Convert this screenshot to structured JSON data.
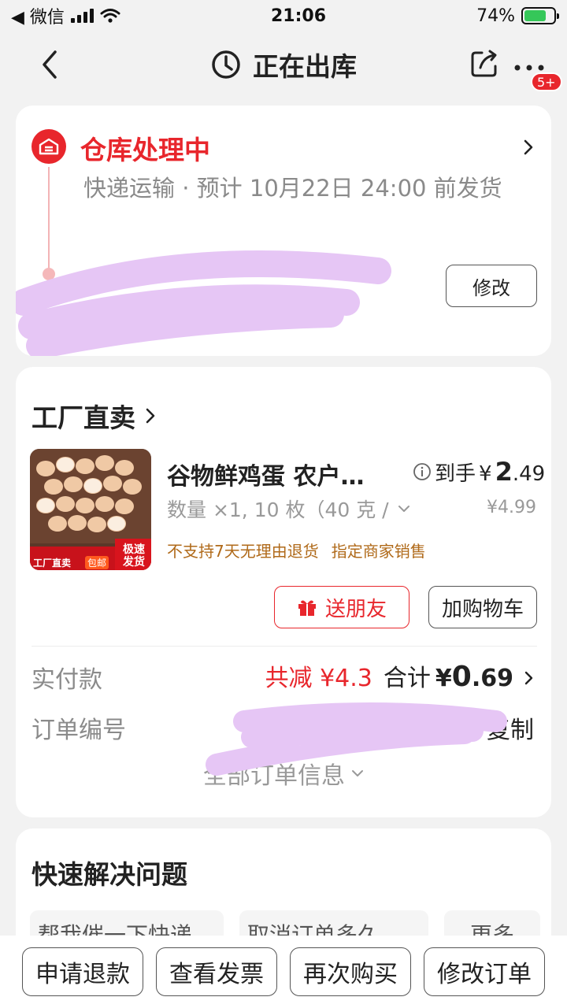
{
  "status_bar": {
    "carrier": "◀ 微信",
    "time": "21:06",
    "battery": "74%",
    "battery_level": 0.74
  },
  "nav": {
    "title": "正在出库",
    "badge": "5+"
  },
  "shipping": {
    "status": "仓库处理中",
    "description": "快递运输 · 预计 10月22日 24:00 前发货",
    "modify_label": "修改"
  },
  "order": {
    "store_name": "工厂直卖",
    "product": {
      "name": "谷物鲜鸡蛋 农户…",
      "price_prefix": "到手",
      "currency": "¥",
      "price_int": "2",
      "price_dec": ".49",
      "spec": "数量 ×1, 10 枚（40 克 /",
      "original_price": "¥4.99",
      "tags": [
        "不支持7天无理由退货",
        "指定商家销售"
      ],
      "thumb_labels": {
        "factory": "工厂直卖",
        "shipping": "包邮",
        "fast": "极速发货"
      }
    },
    "gift_label": "送朋友",
    "cart_label": "加购物车",
    "payment_label": "实付款",
    "discount": "共减 ¥4.3",
    "total_prefix": "合计",
    "total_currency": "¥",
    "total_int": "0",
    "total_dec": ".69",
    "order_number_label": "订单编号",
    "copy_label": "复制",
    "all_info_label": "全部订单信息"
  },
  "quick_solve": {
    "title": "快速解决问题",
    "chips": [
      "帮我催一下快递",
      "取消订单多久",
      "更多"
    ]
  },
  "bottom_actions": [
    "申请退款",
    "查看发票",
    "再次购买",
    "修改订单"
  ],
  "colors": {
    "accent_red": "#e8262c",
    "tag_brown": "#b06a1a",
    "redaction": "#e6c6f5"
  }
}
